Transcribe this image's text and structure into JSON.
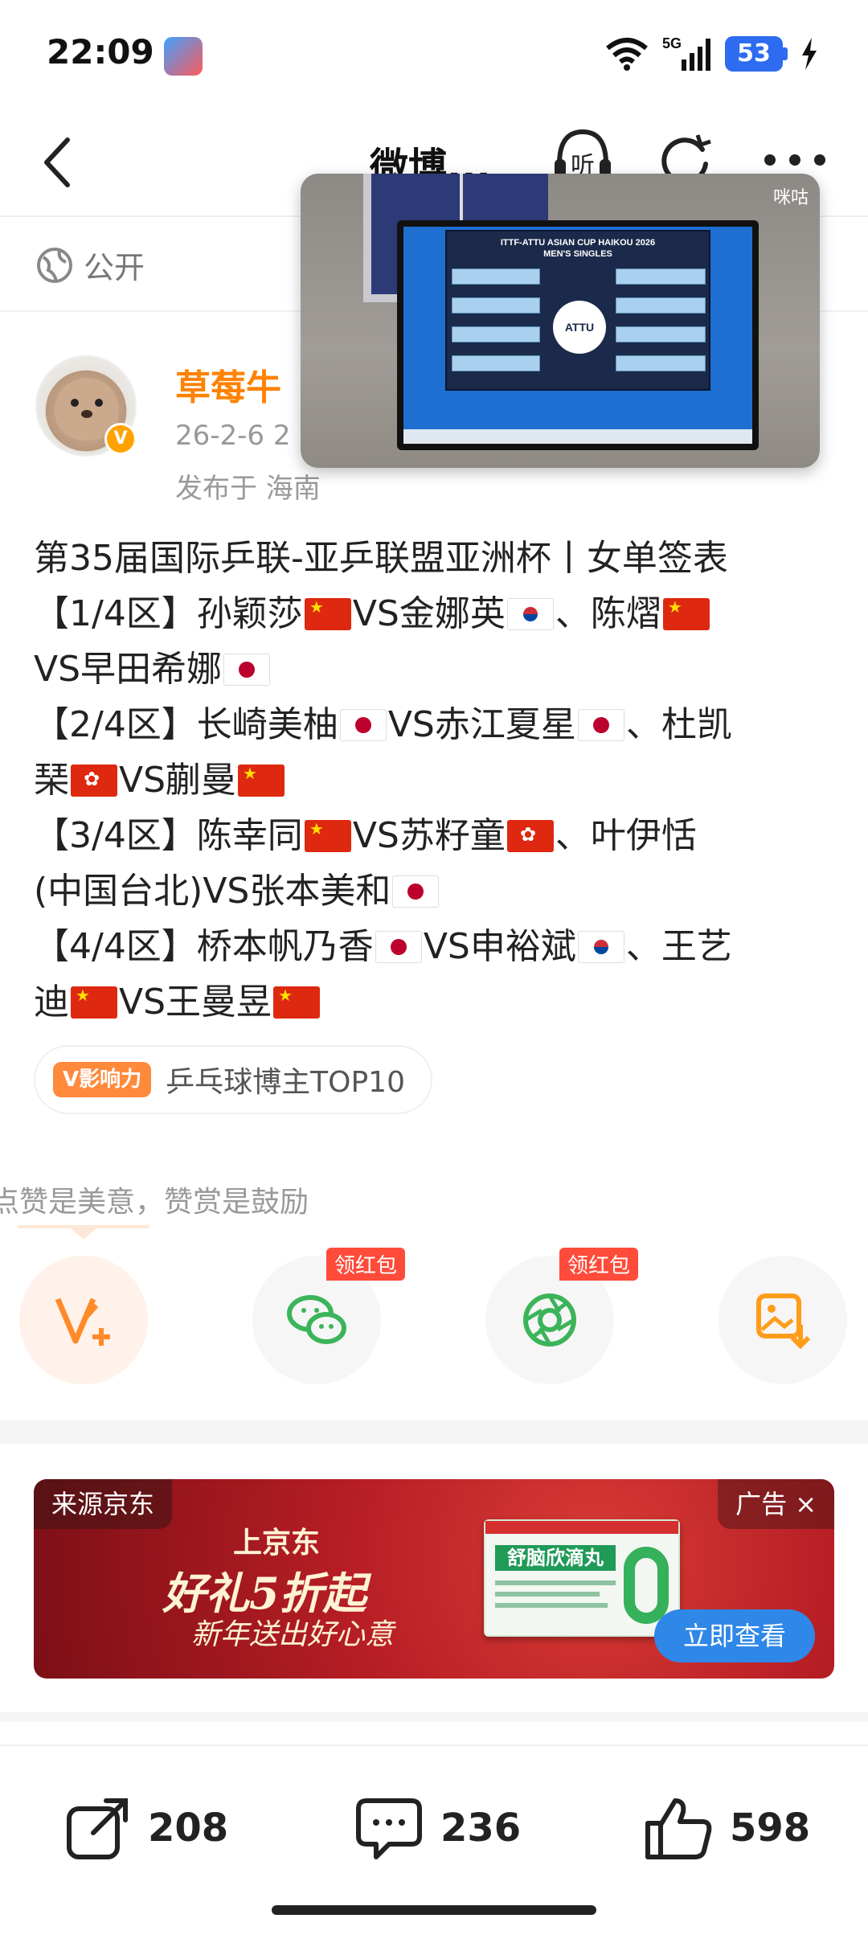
{
  "status_bar": {
    "time": "22:09",
    "network": "5G",
    "battery": "53",
    "icons": [
      "app-icon",
      "wifi-icon",
      "signal-icon",
      "battery-icon",
      "charging-icon"
    ]
  },
  "nav": {
    "title": "微博...",
    "listen_label": "听",
    "icons": [
      "back-icon",
      "listen-icon",
      "refresh-icon",
      "more-icon"
    ]
  },
  "visibility": {
    "label": "公开",
    "icon": "globe-icon"
  },
  "video": {
    "watermark": "咪咕",
    "screen_title": "ITTF-ATTU ASIAN CUP HAIKOU 2026",
    "screen_subtitle": "MEN'S SINGLES",
    "ball_text": "ATTU"
  },
  "author": {
    "name": "草莓牛",
    "time": "26-2-6 2",
    "location": "发布于 海南",
    "verified_badge": "V"
  },
  "post": {
    "lines": [
      {
        "segments": [
          {
            "t": "第35届国际乒联-亚乒联盟亚洲杯丨女单签表"
          }
        ]
      },
      {
        "segments": [
          {
            "t": "【1/4区】孙颖莎"
          },
          {
            "flag": "cn"
          },
          {
            "t": "VS金娜英"
          },
          {
            "flag": "kr"
          },
          {
            "t": "、陈熠"
          },
          {
            "flag": "cn"
          }
        ]
      },
      {
        "segments": [
          {
            "t": "VS早田希娜"
          },
          {
            "flag": "jp"
          }
        ]
      },
      {
        "segments": [
          {
            "t": "【2/4区】长崎美柚"
          },
          {
            "flag": "jp"
          },
          {
            "t": "VS赤江夏星"
          },
          {
            "flag": "jp"
          },
          {
            "t": "、杜凯"
          }
        ]
      },
      {
        "segments": [
          {
            "t": "琹"
          },
          {
            "flag": "hk"
          },
          {
            "t": "VS蒯曼"
          },
          {
            "flag": "cn"
          }
        ]
      },
      {
        "segments": [
          {
            "t": "【3/4区】陈幸同"
          },
          {
            "flag": "cn"
          },
          {
            "t": "VS苏籽童"
          },
          {
            "flag": "hk"
          },
          {
            "t": "、叶伊恬"
          }
        ]
      },
      {
        "segments": [
          {
            "t": "(中国台北)VS张本美和"
          },
          {
            "flag": "jp"
          }
        ]
      },
      {
        "segments": [
          {
            "t": "【4/4区】桥本帆乃香"
          },
          {
            "flag": "jp"
          },
          {
            "t": "VS申裕斌"
          },
          {
            "flag": "kr"
          },
          {
            "t": "、王艺"
          }
        ]
      },
      {
        "segments": [
          {
            "t": "迪"
          },
          {
            "flag": "cn"
          },
          {
            "t": "VS王曼昱"
          },
          {
            "flag": "cn"
          }
        ]
      }
    ]
  },
  "influence": {
    "badge": "V影响力",
    "text": "乒乓球博主TOP10"
  },
  "reward_tip": "点赞是美意，赞赏是鼓励",
  "share_actions": [
    {
      "name": "reward-v-icon",
      "badge": ""
    },
    {
      "name": "wechat-icon",
      "badge": "领红包"
    },
    {
      "name": "moments-icon",
      "badge": "领红包"
    },
    {
      "name": "save-image-icon",
      "badge": ""
    }
  ],
  "ad": {
    "source": "来源京东",
    "label": "广告",
    "close": "×",
    "headline_1": "上京东",
    "headline_2": "好礼5折起",
    "headline_3": "新年送出好心意",
    "product": "舒脑欣滴丸",
    "cta": "立即查看"
  },
  "bottom_bar": {
    "repost_count": "208",
    "comment_count": "236",
    "like_count": "598"
  },
  "colors": {
    "accent_orange": "#ff8200",
    "verify_badge": "#ffa200",
    "battery_blue": "#2d6cf0",
    "cta_blue": "#2f87e8",
    "red_badge": "#ff4b3a"
  }
}
